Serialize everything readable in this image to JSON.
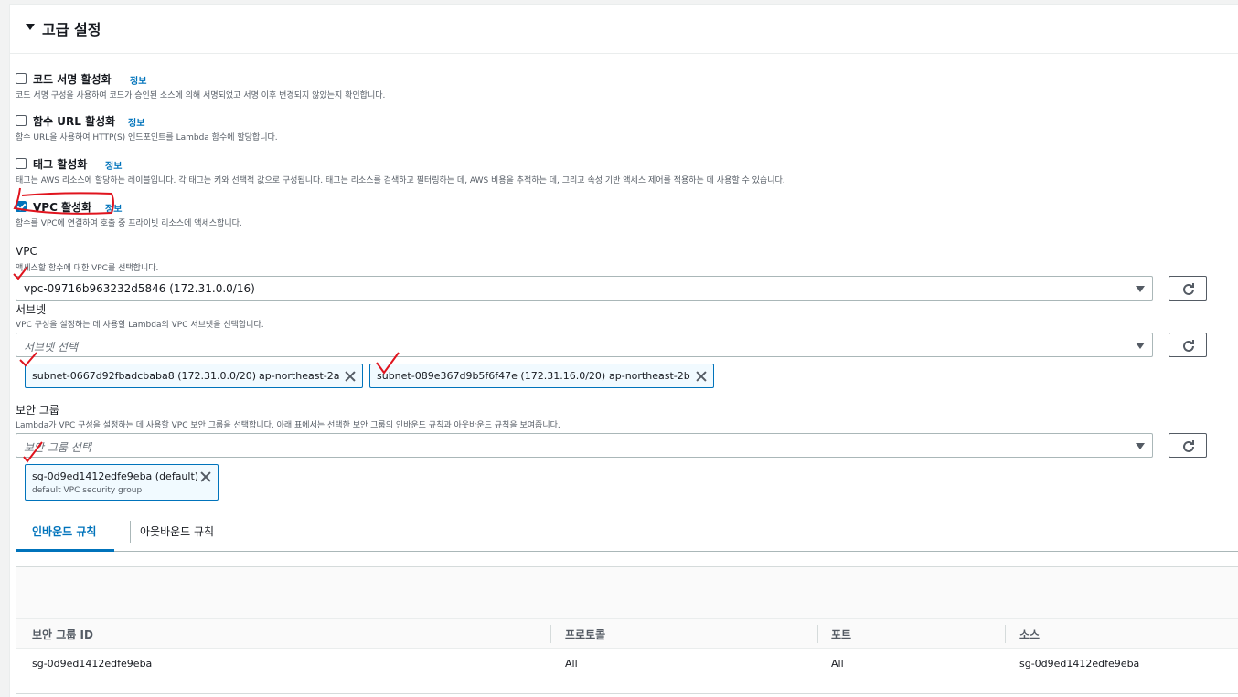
{
  "section": {
    "title": "고급 설정"
  },
  "options": [
    {
      "label": "코드 서명 활성화",
      "info": "정보",
      "desc": "코드 서명 구성을 사용하여 코드가 승인된 소스에 의해 서명되었고 서명 이후 변경되지 않았는지 확인합니다.",
      "checked": false
    },
    {
      "label": "함수 URL 활성화",
      "info": "정보",
      "desc": "함수 URL을 사용하여 HTTP(S) 엔드포인트를 Lambda 함수에 할당합니다.",
      "checked": false
    },
    {
      "label": "태그 활성화",
      "info": "정보",
      "desc": "태그는 AWS 리소스에 할당하는 레이블입니다. 각 태그는 키와 선택적 값으로 구성됩니다. 태그는 리소스를 검색하고 필터링하는 데, AWS 비용을 추적하는 데, 그리고 속성 기반 액세스 제어를 적용하는 데 사용할 수 있습니다.",
      "checked": false
    },
    {
      "label": "VPC 활성화",
      "info": "정보",
      "desc": "함수를 VPC에 연결하여 호출 중 프라이빗 리소스에 액세스합니다.",
      "checked": true
    }
  ],
  "vpc": {
    "label": "VPC",
    "desc": "액세스할 함수에 대한 VPC를 선택합니다.",
    "value": "vpc-09716b963232d5846 (172.31.0.0/16)"
  },
  "subnet": {
    "label": "서브넷",
    "desc": "VPC 구성을 설정하는 데 사용할 Lambda의 VPC 서브넷을 선택합니다.",
    "placeholder": "서브넷 선택",
    "tokens": [
      {
        "id": "subnet-0667d92fbadcbaba8 (172.31.0.0/20)",
        "az": "ap-northeast-2a"
      },
      {
        "id": "subnet-089e367d9b5f6f47e (172.31.16.0/20)",
        "az": "ap-northeast-2b"
      }
    ]
  },
  "security_group": {
    "label": "보안 그룹",
    "desc": "Lambda가 VPC 구성을 설정하는 데 사용할 VPC 보안 그룹을 선택합니다. 아래 표에서는 선택한 보안 그룹의 인바운드 규칙과 아웃바운드 규칙을 보여줍니다.",
    "placeholder": "보안 그룹 선택",
    "token": {
      "id": "sg-0d9ed1412edfe9eba (default)",
      "sub": "default VPC security group"
    }
  },
  "tabs": [
    "인바운드 규칙",
    "아웃바운드 규칙"
  ],
  "table": {
    "headers": [
      "보안 그룹 ID",
      "프로토콜",
      "포트",
      "소스"
    ],
    "rows": [
      [
        "sg-0d9ed1412edfe9eba",
        "All",
        "All",
        "sg-0d9ed1412edfe9eba"
      ]
    ]
  },
  "colors": {
    "accent": "#0073bb",
    "annotation": "#e0141e"
  }
}
